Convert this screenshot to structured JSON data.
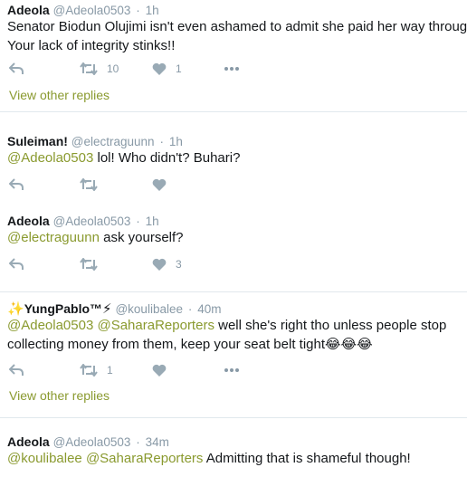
{
  "colors": {
    "accent": "#8a9a2f",
    "muted": "#8899a6",
    "divider": "#e1e8ed"
  },
  "tweets": [
    {
      "name": "Adeola",
      "handle": "@Adeola0503",
      "sep": "·",
      "time": "1h",
      "line1": "Senator Biodun Olujimi isn't even ashamed to admit she paid her way through!",
      "line2": "Your lack of integrity stinks!!",
      "retweets": "10",
      "likes": "1",
      "view_replies": "View other replies"
    },
    {
      "name": "Suleiman!",
      "handle": "@electraguunn",
      "sep": "·",
      "time": "1h",
      "mention1": "@Adeola0503",
      "text": " lol! Who didn't? Buhari?"
    },
    {
      "name": "Adeola",
      "handle": "@Adeola0503",
      "sep": "·",
      "time": "1h",
      "mention1": "@electraguunn",
      "text": " ask yourself?",
      "likes": "3"
    },
    {
      "name_prefix_emoji": "✨",
      "name": "YungPablo™",
      "name_suffix_emoji": "⚡",
      "handle": "@koulibalee",
      "sep": "·",
      "time": "40m",
      "mention1": "@Adeola0503",
      "mention2": "@SaharaReporters",
      "text": " well she's right tho unless people stop",
      "line2": "collecting money from them, keep your seat belt tight",
      "line2_emoji": "😂😂😂",
      "retweets": "1",
      "view_replies": "View other replies"
    },
    {
      "name": "Adeola",
      "handle": "@Adeola0503",
      "sep": "·",
      "time": "34m",
      "mention1": "@koulibalee",
      "mention2": "@SaharaReporters",
      "text": " Admitting that is shameful though!"
    }
  ],
  "icons": {
    "reply": "reply-icon",
    "retweet": "retweet-icon",
    "like": "heart-icon",
    "more": "more-icon"
  }
}
